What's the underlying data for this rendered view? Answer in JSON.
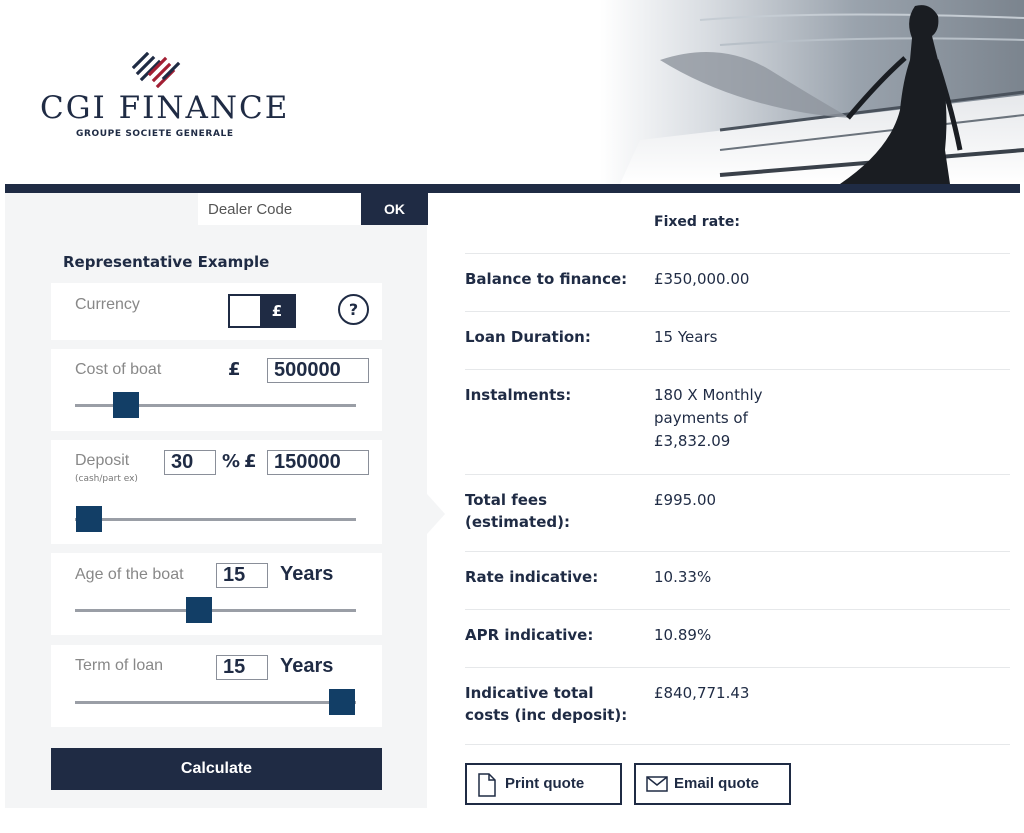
{
  "brand": {
    "name": "CGI FINANCE",
    "tagline": "GROUPE SOCIETE GENERALE",
    "colors": {
      "primary": "#1f2b44",
      "accent": "#123e66",
      "logo_red": "#a31f34"
    }
  },
  "dealer": {
    "placeholder": "Dealer Code",
    "ok_label": "OK"
  },
  "calculator": {
    "title": "Representative Example",
    "currency": {
      "label": "Currency",
      "selected": "£",
      "help": "?"
    },
    "cost": {
      "label": "Cost of boat",
      "symbol": "£",
      "value": "500000",
      "slider_fraction": 0.18
    },
    "deposit": {
      "label": "Deposit",
      "sublabel": "(cash/part ex)",
      "percent": "30",
      "percent_symbol": "%",
      "symbol": "£",
      "amount": "150000",
      "slider_fraction": 0.05
    },
    "age": {
      "label": "Age of the boat",
      "value": "15",
      "unit": "Years",
      "slider_fraction": 0.44
    },
    "term": {
      "label": "Term of loan",
      "value": "15",
      "unit": "Years",
      "slider_fraction": 0.95
    },
    "calculate_label": "Calculate"
  },
  "results": {
    "header": "Fixed rate:",
    "rows": [
      {
        "label": "Balance to finance:",
        "value": "£350,000.00"
      },
      {
        "label": "Loan Duration:",
        "value": "15 Years"
      },
      {
        "label": "Instalments:",
        "value": "180 X Monthly payments of £3,832.09"
      },
      {
        "label": "Total fees (estimated):",
        "value": "£995.00"
      },
      {
        "label": "Rate indicative:",
        "value": "10.33%"
      },
      {
        "label": "APR indicative:",
        "value": "10.89%"
      },
      {
        "label": "Indicative total costs (inc deposit):",
        "value": "£840,771.43"
      }
    ],
    "print_label": "Print quote",
    "email_label": "Email quote"
  }
}
